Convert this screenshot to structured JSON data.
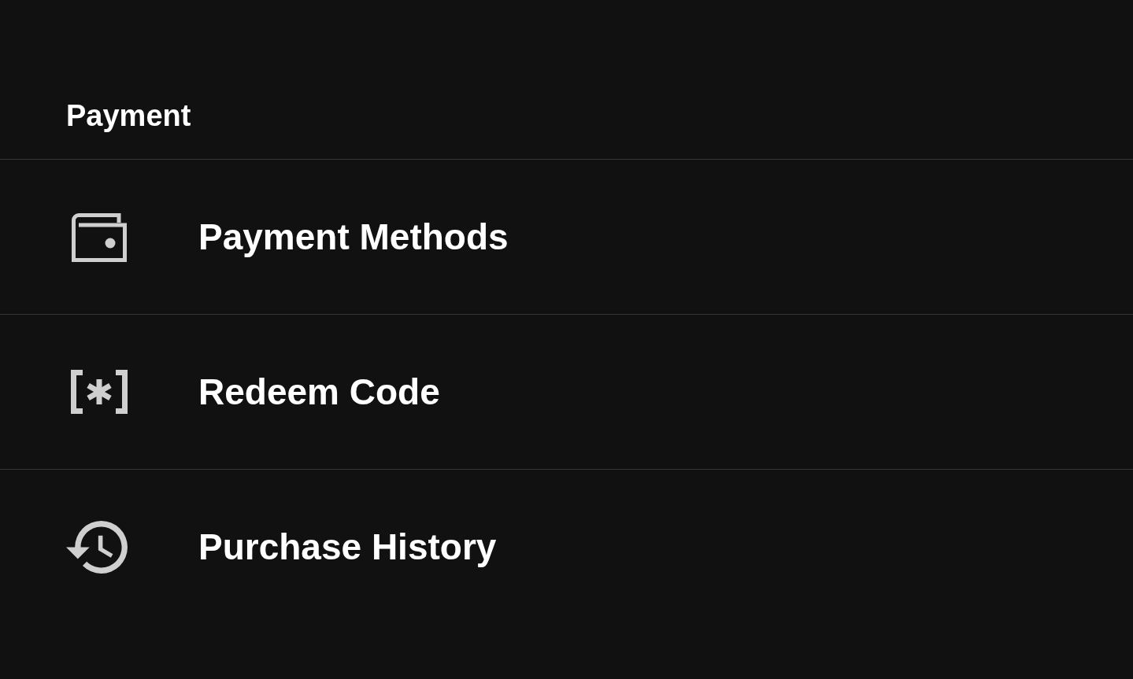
{
  "header": {
    "title": "Payment"
  },
  "items": [
    {
      "label": "Payment Methods"
    },
    {
      "label": "Redeem Code"
    },
    {
      "label": "Purchase History"
    }
  ]
}
